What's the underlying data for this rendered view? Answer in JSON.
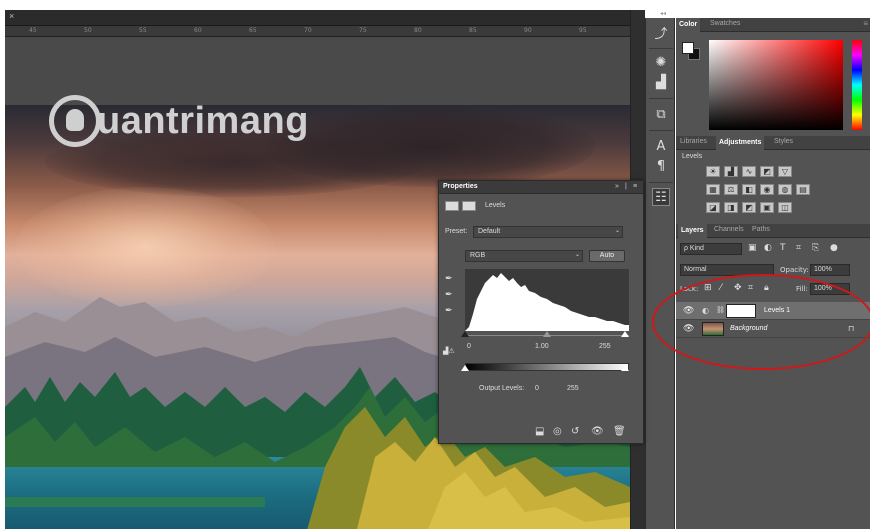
{
  "document": {
    "close_glyph": "×"
  },
  "ruler": {
    "ticks": [
      "45",
      "50",
      "55",
      "60",
      "65",
      "70",
      "75",
      "80",
      "85",
      "90",
      "95"
    ]
  },
  "watermark": {
    "text": "uantrimang"
  },
  "color_panel": {
    "tabs": [
      "Color",
      "Swatches"
    ],
    "foreground": "#ffffff",
    "background": "#111111"
  },
  "adjustments_panel": {
    "tabs": [
      "Libraries",
      "Adjustments",
      "Styles"
    ],
    "active_tab": "Adjustments",
    "section_title": "Levels"
  },
  "layers_panel": {
    "tabs": [
      "Layers",
      "Channels",
      "Paths"
    ],
    "active_tab": "Layers",
    "filter_label": "ρ Kind",
    "blend_mode": "Normal",
    "opacity_label": "Opacity:",
    "opacity_value": "100%",
    "lock_label": "Lock:",
    "fill_label": "Fill:",
    "fill_value": "100%",
    "layers": [
      {
        "name": "Levels 1",
        "selected": true
      },
      {
        "name": "Background",
        "selected": false,
        "locked": true
      }
    ]
  },
  "properties_panel": {
    "title": "Properties",
    "header_label": "Levels",
    "preset_label": "Preset:",
    "preset_value": "Default",
    "channel_value": "RGB",
    "auto_button": "Auto",
    "input_black": "0",
    "input_gamma": "1.00",
    "input_white": "255",
    "output_label": "Output Levels:",
    "output_black": "0",
    "output_white": "255"
  },
  "annotation": {
    "color": "#d01818"
  }
}
